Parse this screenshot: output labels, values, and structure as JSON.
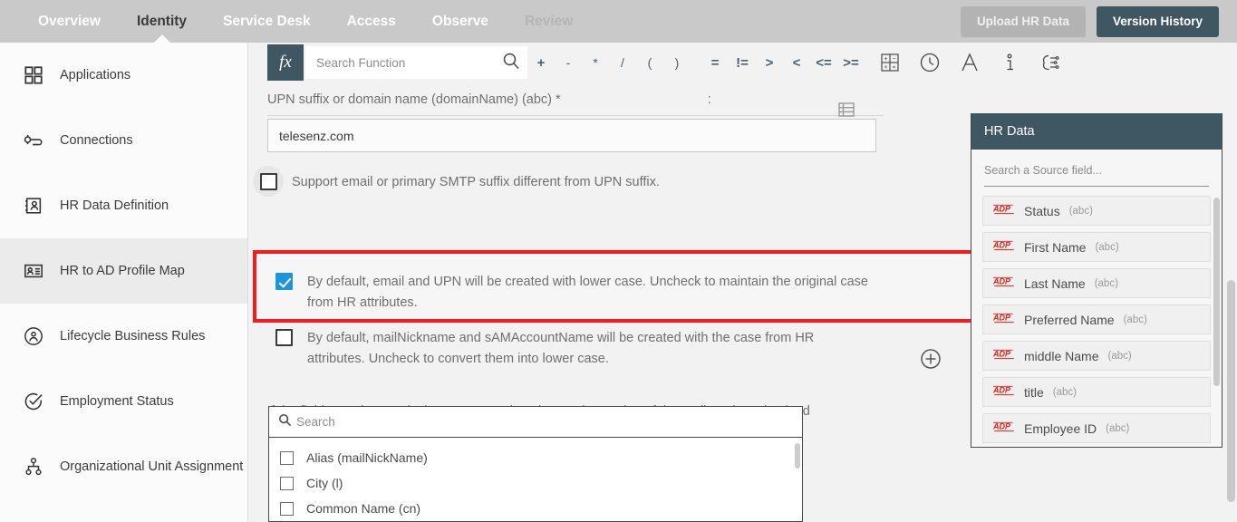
{
  "topnav": {
    "tabs": [
      {
        "label": "Overview",
        "state": "normal"
      },
      {
        "label": "Identity",
        "state": "active"
      },
      {
        "label": "Service Desk",
        "state": "normal"
      },
      {
        "label": "Access",
        "state": "normal"
      },
      {
        "label": "Observe",
        "state": "normal"
      },
      {
        "label": "Review",
        "state": "dim"
      }
    ],
    "upload_button": "Upload HR Data",
    "version_button": "Version History",
    "bg_color": "#c9c9c9",
    "accent_color": "#3f5663"
  },
  "sidebar": {
    "items": [
      {
        "label": "Applications",
        "icon": "grid-icon",
        "selected": false
      },
      {
        "label": "Connections",
        "icon": "plug-icon",
        "selected": false
      },
      {
        "label": "HR Data Definition",
        "icon": "contact-card-icon",
        "selected": false
      },
      {
        "label": "HR to AD Profile Map",
        "icon": "id-badge-icon",
        "selected": true
      },
      {
        "label": "Lifecycle Business Rules",
        "icon": "user-circle-icon",
        "selected": false
      },
      {
        "label": "Employment Status",
        "icon": "check-circle-icon",
        "selected": false
      },
      {
        "label": "Organizational Unit Assignment",
        "icon": "hierarchy-icon",
        "selected": false
      }
    ]
  },
  "formula_bar": {
    "fx_label": "fx",
    "search_placeholder": "Search Function",
    "search_value": "",
    "operators": [
      "+",
      "-",
      "*",
      "/",
      "(",
      ")",
      "=",
      "!=",
      ">",
      "<",
      "<=",
      ">="
    ],
    "tools": [
      "calculator-icon",
      "clock-icon",
      "text-icon",
      "info-icon",
      "ai-icon"
    ]
  },
  "field": {
    "label": "UPN suffix or domain name (domainName) (abc) *",
    "colon": ":",
    "value": "telesenz.com",
    "grid_icon": "table-icon"
  },
  "checkboxes": [
    {
      "label": "Support email or primary SMTP suffix different from UPN suffix.",
      "checked": false,
      "hovered": true,
      "highlighted": false
    },
    {
      "label": "By default, email and UPN will be created with lower case. Uncheck to maintain the original case from HR attributes.",
      "checked": true,
      "hovered": false,
      "highlighted": true
    },
    {
      "label": "By default, mailNickname and sAMAccountName will be created with the case from HR attributes. Uncheck to convert them into lower case.",
      "checked": false,
      "hovered": false,
      "highlighted": false
    }
  ],
  "highlight_color": "#f41d1d",
  "checkbox_checked_color": "#1b95dd",
  "note": "If the field mapping results in an empty value, the previous value of the attribute is maintained by default. Override to clear the field value for the selected attribute.",
  "add_button_icon": "plus-circle-icon",
  "attribute_picker": {
    "search_placeholder": "Search",
    "search_value": "",
    "search_icon": "search-icon",
    "items": [
      {
        "label": "Alias (mailNickName)",
        "checked": false
      },
      {
        "label": "City (l)",
        "checked": false
      },
      {
        "label": "Common Name (cn)",
        "checked": false
      }
    ]
  },
  "hr_panel": {
    "title": "HR Data",
    "search_placeholder": "Search a Source field...",
    "search_value": "",
    "items": [
      {
        "name": "Status",
        "type": "(abc)",
        "icon": "adp-logo-icon"
      },
      {
        "name": "First Name",
        "type": "(abc)",
        "icon": "adp-logo-icon"
      },
      {
        "name": "Last Name",
        "type": "(abc)",
        "icon": "adp-logo-icon"
      },
      {
        "name": "Preferred Name",
        "type": "(abc)",
        "icon": "adp-logo-icon"
      },
      {
        "name": "middle Name",
        "type": "(abc)",
        "icon": "adp-logo-icon"
      },
      {
        "name": "title",
        "type": "(abc)",
        "icon": "adp-logo-icon"
      },
      {
        "name": "Employee ID",
        "type": "(abc)",
        "icon": "adp-logo-icon"
      }
    ]
  }
}
